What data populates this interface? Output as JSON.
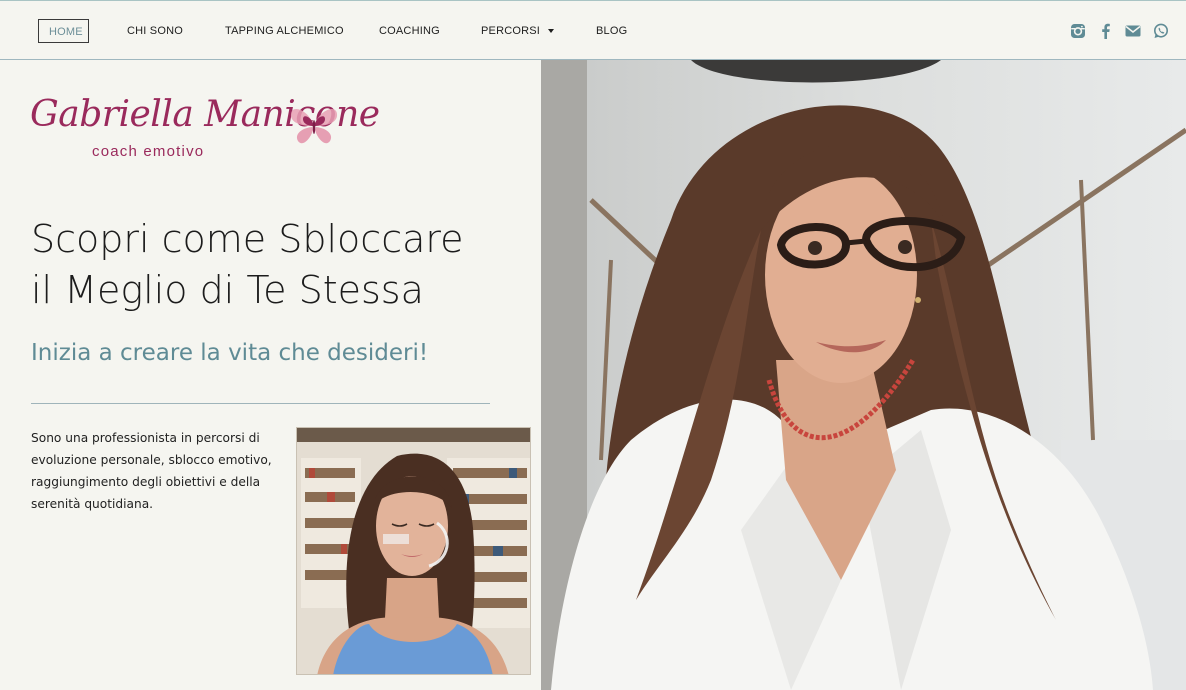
{
  "nav": {
    "items": [
      {
        "label": "HOME",
        "active": true
      },
      {
        "label": "CHI SONO"
      },
      {
        "label": "TAPPING ALCHEMICO"
      },
      {
        "label": "COACHING"
      },
      {
        "label": "PERCORSI",
        "dropdown": true
      },
      {
        "label": "BLOG"
      }
    ],
    "social": [
      "instagram-icon",
      "facebook-icon",
      "envelope-icon",
      "whatsapp-icon"
    ]
  },
  "logo": {
    "name": "Gabriella Manicone",
    "tagline": "coach emotivo"
  },
  "hero": {
    "headline_line1": "Scopri come Sbloccare",
    "headline_line2": "il Meglio di Te Stessa",
    "subheadline": "Inizia a creare la vita che desideri!",
    "bio": "Sono una professionista in percorsi di evoluzione personale, sblocco emotivo, raggiungimento degli obiettivi e della serenità quotidiana."
  },
  "colors": {
    "background": "#f5f5f0",
    "brand": "#9a2a5c",
    "accent": "#5f8b95",
    "icon": "#5f8b95"
  }
}
